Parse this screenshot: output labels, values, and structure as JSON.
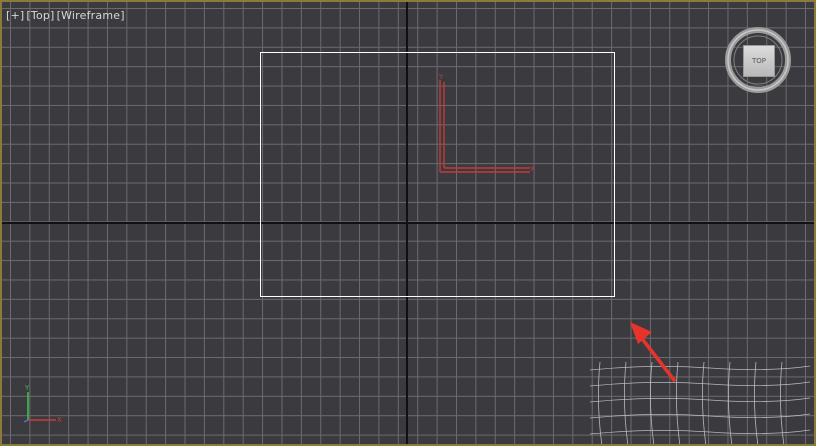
{
  "viewport": {
    "label": {
      "plus": "[+]",
      "view": "[Top]",
      "shading": "[Wireframe]"
    },
    "viewcube_label": "TOP",
    "gizmo": {
      "y_label": "Y",
      "x_label": "X"
    },
    "corner_axes": {
      "y_label": "Y",
      "x_label": "X"
    },
    "colors": {
      "background": "#3b3a3f",
      "grid": "#6c6b70",
      "home_axes": "#111111",
      "selection": "#ffffff",
      "gizmo": "#c23a3a",
      "annotation_arrow": "#e8332a",
      "border": "#8a7a3c"
    }
  }
}
